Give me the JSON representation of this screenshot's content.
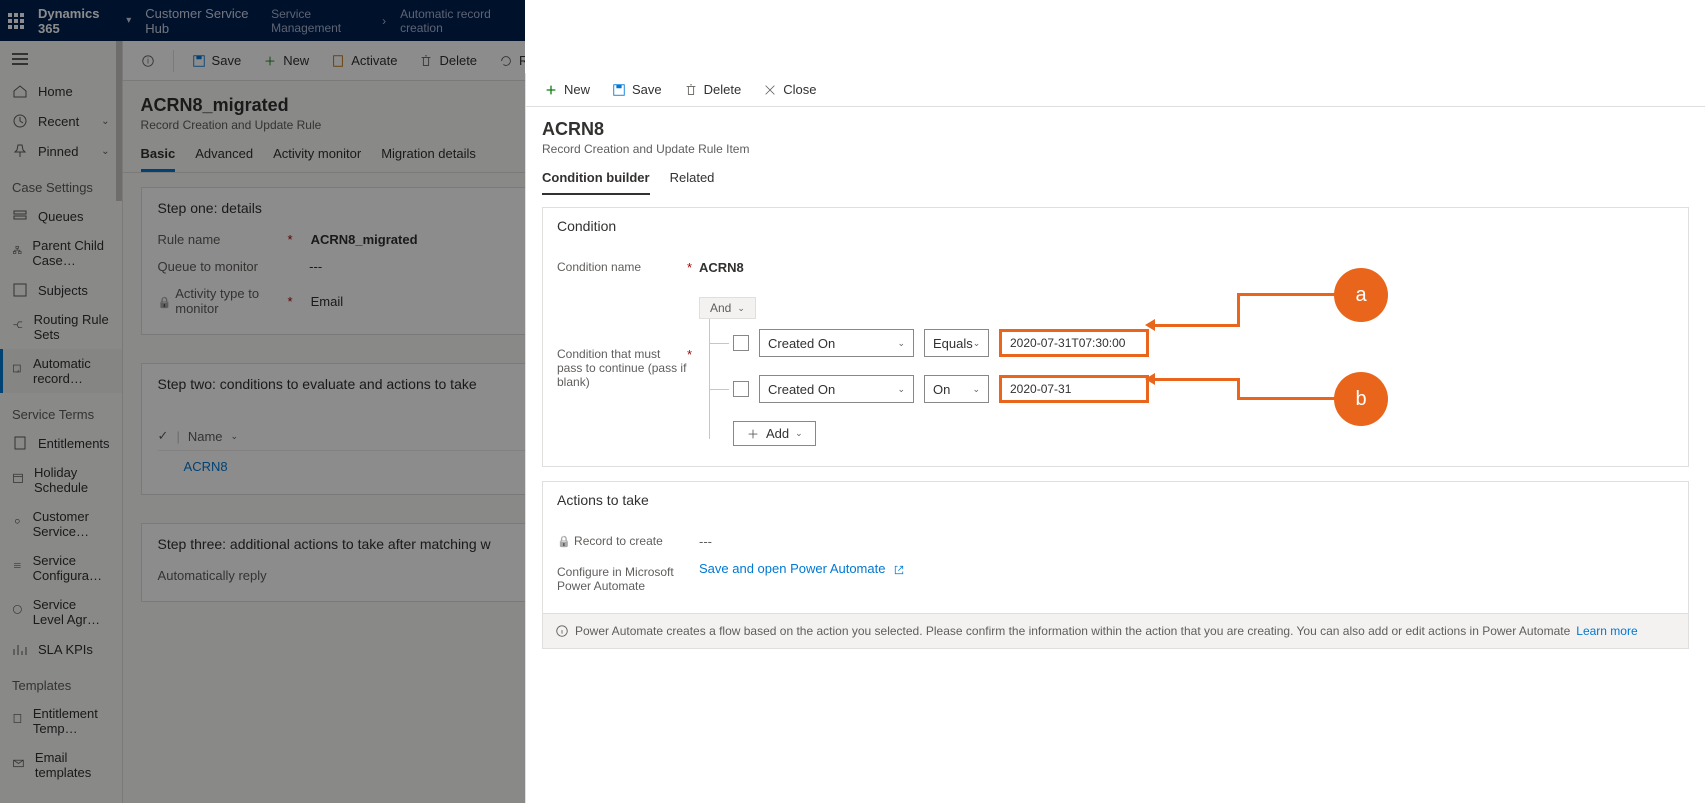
{
  "topbar": {
    "brand": "Dynamics 365",
    "hub": "Customer Service Hub",
    "crumb1": "Service Management",
    "crumb2": "Automatic record creation"
  },
  "nav": {
    "home": "Home",
    "recent": "Recent",
    "pinned": "Pinned",
    "sec_case": "Case Settings",
    "queues": "Queues",
    "parent": "Parent Child Case…",
    "subjects": "Subjects",
    "routing": "Routing Rule Sets",
    "auto": "Automatic record…",
    "sec_terms": "Service Terms",
    "entitle": "Entitlements",
    "holiday": "Holiday Schedule",
    "custsvc": "Customer Service…",
    "svcconf": "Service Configura…",
    "sla": "Service Level Agr…",
    "slakpi": "SLA KPIs",
    "sec_tmpl": "Templates",
    "enttmpl": "Entitlement Temp…",
    "emailtmpl": "Email templates"
  },
  "cmd": {
    "save": "Save",
    "new": "New",
    "activate": "Activate",
    "delete": "Delete",
    "refresh": "Refr"
  },
  "page": {
    "title": "ACRN8_migrated",
    "subtitle": "Record Creation and Update Rule"
  },
  "tabs": {
    "basic": "Basic",
    "advanced": "Advanced",
    "activity": "Activity monitor",
    "migration": "Migration details"
  },
  "step1": {
    "title": "Step one: details",
    "rule_lbl": "Rule name",
    "rule_val": "ACRN8_migrated",
    "queue_lbl": "Queue to monitor",
    "queue_val": "---",
    "act_lbl": "Activity type to monitor",
    "act_val": "Email"
  },
  "step2": {
    "title": "Step two: conditions to evaluate and actions to take",
    "col": "Name",
    "row": "ACRN8"
  },
  "step3": {
    "title": "Step three: additional actions to take after matching w",
    "auto": "Automatically reply"
  },
  "panel_cmd": {
    "new": "New",
    "save": "Save",
    "delete": "Delete",
    "close": "Close"
  },
  "panel_head": {
    "title": "ACRN8",
    "subtitle": "Record Creation and Update Rule Item"
  },
  "panel_tabs": {
    "cond": "Condition builder",
    "rel": "Related"
  },
  "cond": {
    "section": "Condition",
    "name_lbl": "Condition name",
    "name_val": "ACRN8",
    "pass_lbl": "Condition that must pass to continue (pass if blank)",
    "and": "And",
    "field": "Created On",
    "op1": "Equals",
    "val1": "2020-07-31T07:30:00",
    "op2": "On",
    "val2": "2020-07-31",
    "add": "Add"
  },
  "actions": {
    "section": "Actions to take",
    "rec_lbl": "Record to create",
    "rec_val": "---",
    "conf_lbl": "Configure in Microsoft Power Automate",
    "save_open": "Save and open Power Automate",
    "info": "Power Automate creates a flow based on the action you selected. Please confirm the information within the action that you are creating. You can also add or edit actions in Power Automate",
    "learn": "Learn more"
  },
  "anno": {
    "a": "a",
    "b": "b"
  }
}
